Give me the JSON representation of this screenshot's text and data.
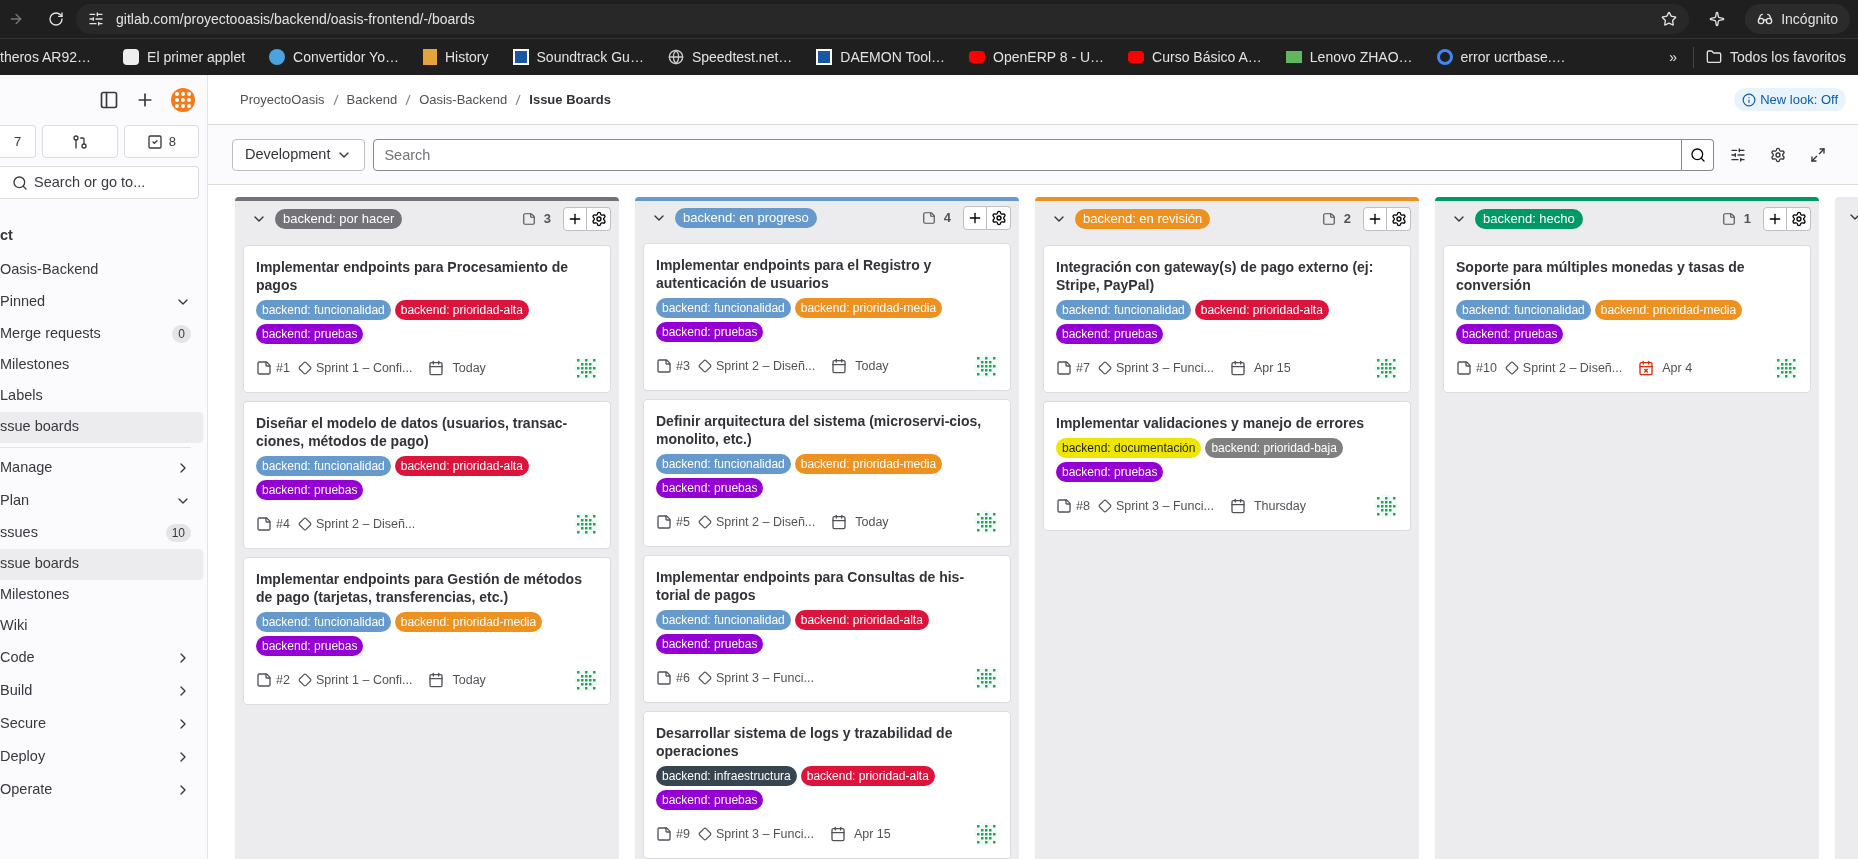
{
  "browser": {
    "url": "gitlab.com/proyectooasis/backend/oasis-frontend/-/boards",
    "profile": "Incógnito",
    "bookmarks": [
      {
        "kind": "plain",
        "text": "theros AR92…"
      },
      {
        "kind": "applet",
        "text": "El primer applet"
      },
      {
        "kind": "convert",
        "text": "Convertidor Yo…"
      },
      {
        "kind": "history",
        "text": "History"
      },
      {
        "kind": "square",
        "text": "Soundtrack Gu…"
      },
      {
        "kind": "globe",
        "text": "Speedtest.net…"
      },
      {
        "kind": "square",
        "text": "DAEMON Tool…"
      },
      {
        "kind": "video",
        "text": "OpenERP 8 - U…"
      },
      {
        "kind": "video",
        "text": "Curso Básico A…"
      },
      {
        "kind": "image",
        "text": "Lenovo ZHAO…"
      },
      {
        "kind": "google",
        "text": "error ucrtbase.…"
      }
    ],
    "more": "»",
    "all_bookmarks": "Todos los favoritos"
  },
  "sidebar": {
    "counters": [
      {
        "kind": "issues",
        "text": "7"
      },
      {
        "kind": "merge"
      },
      {
        "kind": "todo",
        "text": "8"
      }
    ],
    "search_placeholder": "Search or go to...",
    "project": "ct",
    "items": [
      {
        "kind": "link",
        "label": "Oasis-Backend",
        "selected": false
      },
      {
        "kind": "group",
        "label": "Pinned",
        "expanded": true
      },
      {
        "kind": "link",
        "label": "Merge requests",
        "count": "0",
        "selected": false
      },
      {
        "kind": "link",
        "label": "Milestones",
        "selected": false
      },
      {
        "kind": "link",
        "label": "Labels",
        "selected": false
      },
      {
        "kind": "link",
        "label": "ssue boards",
        "selected": true
      },
      {
        "kind": "divider"
      },
      {
        "kind": "group",
        "label": "Manage",
        "expanded": false
      },
      {
        "kind": "group",
        "label": "Plan",
        "expanded": true
      },
      {
        "kind": "link",
        "label": "ssues",
        "count": "10",
        "selected": false
      },
      {
        "kind": "link",
        "label": "ssue boards",
        "selected": true
      },
      {
        "kind": "link",
        "label": "Milestones",
        "selected": false
      },
      {
        "kind": "link",
        "label": "Wiki",
        "selected": false
      },
      {
        "kind": "group",
        "label": "Code",
        "expanded": false
      },
      {
        "kind": "group",
        "label": "Build",
        "expanded": false
      },
      {
        "kind": "group",
        "label": "Secure",
        "expanded": false
      },
      {
        "kind": "group",
        "label": "Deploy",
        "expanded": false
      },
      {
        "kind": "group",
        "label": "Operate",
        "expanded": false
      }
    ]
  },
  "breadcrumbs": [
    "ProyectoOasis",
    "Backend",
    "Oasis-Backend",
    "Issue Boards"
  ],
  "new_look": "New look: Off",
  "filter": {
    "board": "Development",
    "placeholder": "Search"
  },
  "columns": [
    {
      "label": "backend: por hacer",
      "color": "#737278",
      "count": "3",
      "cards": [
        {
          "title": "Implementar endpoints para Procesamiento de pagos",
          "labels": [
            {
              "text": "backend: funcionalidad",
              "color": "#6699cc"
            },
            {
              "text": "backend: prioridad-alta",
              "color": "#dc143c"
            },
            {
              "text": "backend: pruebas",
              "color": "#9400d3"
            }
          ],
          "number": "#1",
          "milestone": "Sprint 1 – Confi...",
          "due": "Today"
        },
        {
          "title": "Diseñar el modelo de datos (usuarios, transac-ciones, métodos de pago)",
          "labels": [
            {
              "text": "backend: funcionalidad",
              "color": "#6699cc"
            },
            {
              "text": "backend: prioridad-alta",
              "color": "#dc143c"
            },
            {
              "text": "backend: pruebas",
              "color": "#9400d3"
            }
          ],
          "number": "#4",
          "milestone": "Sprint 2 – Diseñ..."
        },
        {
          "title": "Implementar endpoints para Gestión de métodos de pago (tarjetas, transferencias, etc.)",
          "labels": [
            {
              "text": "backend: funcionalidad",
              "color": "#6699cc"
            },
            {
              "text": "backend: prioridad-media",
              "color": "#ed9121"
            },
            {
              "text": "backend: pruebas",
              "color": "#9400d3"
            }
          ],
          "number": "#2",
          "milestone": "Sprint 1 – Confi...",
          "due": "Today"
        }
      ]
    },
    {
      "label": "backend: en progreso",
      "color": "#6699cc",
      "count": "4",
      "cards": [
        {
          "title": "Implementar endpoints para el Registro y autenticación de usuarios",
          "labels": [
            {
              "text": "backend: funcionalidad",
              "color": "#6699cc"
            },
            {
              "text": "backend: prioridad-media",
              "color": "#ed9121"
            },
            {
              "text": "backend: pruebas",
              "color": "#9400d3"
            }
          ],
          "number": "#3",
          "milestone": "Sprint 2 – Diseñ...",
          "due": "Today"
        },
        {
          "title": "Definir arquitectura del sistema (microservi-cios, monolito, etc.)",
          "labels": [
            {
              "text": "backend: funcionalidad",
              "color": "#6699cc"
            },
            {
              "text": "backend: prioridad-media",
              "color": "#ed9121"
            },
            {
              "text": "backend: pruebas",
              "color": "#9400d3"
            }
          ],
          "number": "#5",
          "milestone": "Sprint 2 – Diseñ...",
          "due": "Today"
        },
        {
          "title": "Implementar endpoints para Consultas de his-torial de pagos",
          "labels": [
            {
              "text": "backend: funcionalidad",
              "color": "#6699cc"
            },
            {
              "text": "backend: prioridad-alta",
              "color": "#dc143c"
            },
            {
              "text": "backend: pruebas",
              "color": "#9400d3"
            }
          ],
          "number": "#6",
          "milestone": "Sprint 3 – Funci..."
        },
        {
          "title": "Desarrollar sistema de logs y trazabilidad de operaciones",
          "labels": [
            {
              "text": "backend: infraestructura",
              "color": "#36454f"
            },
            {
              "text": "backend: prioridad-alta",
              "color": "#dc143c"
            },
            {
              "text": "backend: pruebas",
              "color": "#9400d3"
            }
          ],
          "number": "#9",
          "milestone": "Sprint 3 – Funci...",
          "due": "Apr 15"
        }
      ]
    },
    {
      "label": "backend: en revisión",
      "color": "#ed9121",
      "count": "2",
      "cards": [
        {
          "title": "Integración con gateway(s) de pago externo (ej: Stripe, PayPal)",
          "labels": [
            {
              "text": "backend: funcionalidad",
              "color": "#6699cc"
            },
            {
              "text": "backend: prioridad-alta",
              "color": "#dc143c"
            },
            {
              "text": "backend: pruebas",
              "color": "#9400d3"
            }
          ],
          "number": "#7",
          "milestone": "Sprint 3 – Funci...",
          "due": "Apr 15"
        },
        {
          "title": "Implementar validaciones y manejo de errores",
          "labels": [
            {
              "text": "backend: documentación",
              "color": "#eee600"
            },
            {
              "text": "backend: prioridad-baja",
              "color": "#808080"
            },
            {
              "text": "backend: pruebas",
              "color": "#9400d3"
            }
          ],
          "number": "#8",
          "milestone": "Sprint 3 – Funci...",
          "due": "Thursday"
        }
      ]
    },
    {
      "label": "backend: hecho",
      "color": "#009966",
      "count": "1",
      "cards": [
        {
          "title": "Soporte para múltiples monedas y tasas de conversión",
          "labels": [
            {
              "text": "backend: funcionalidad",
              "color": "#6699cc"
            },
            {
              "text": "backend: prioridad-media",
              "color": "#ed9121"
            },
            {
              "text": "backend: pruebas",
              "color": "#9400d3"
            }
          ],
          "number": "#10",
          "milestone": "Sprint 2 – Diseñ...",
          "due": "Apr 4",
          "overdue": true
        }
      ]
    }
  ]
}
